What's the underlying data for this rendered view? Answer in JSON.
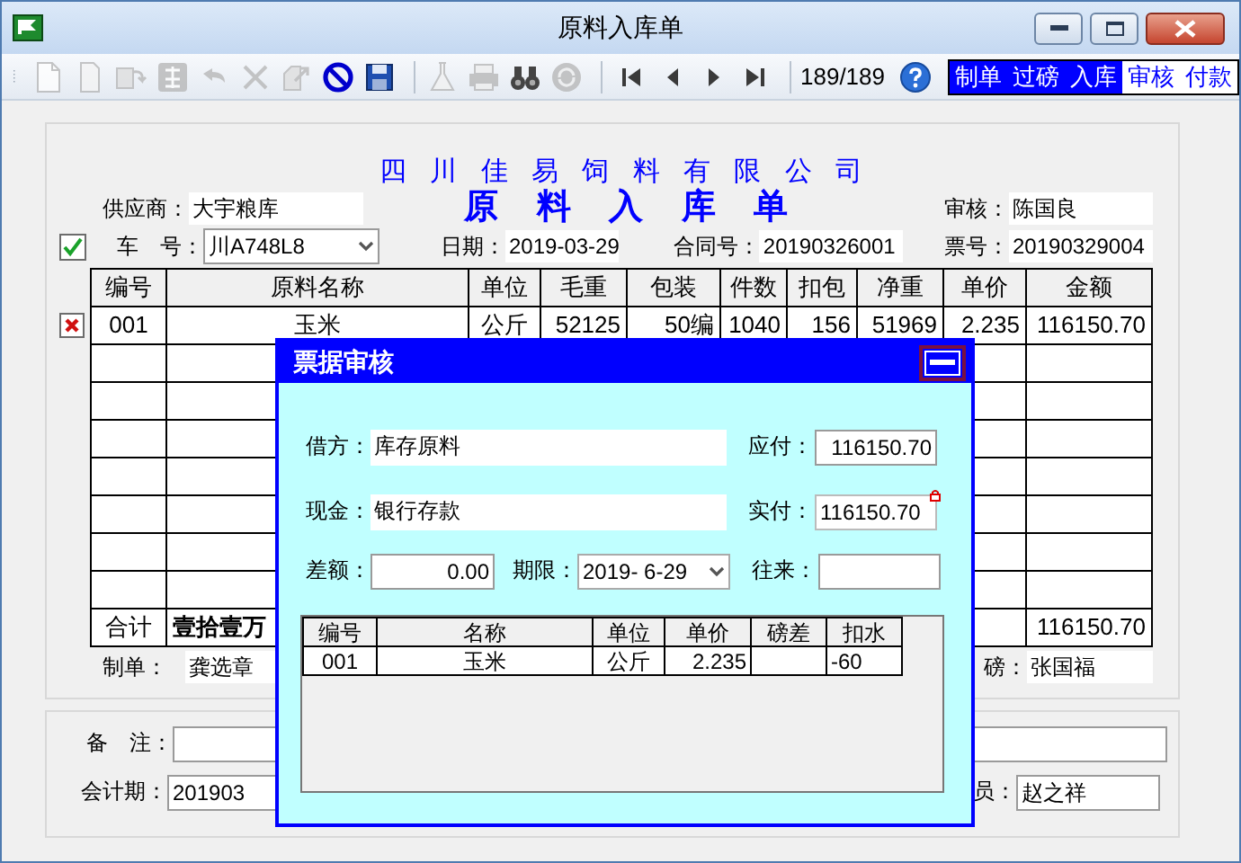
{
  "window": {
    "title": "原料入库单"
  },
  "toolbar": {
    "groups": [
      [
        {
          "kind": "new",
          "disabled": true
        },
        {
          "kind": "copy",
          "disabled": true
        },
        {
          "kind": "import",
          "disabled": true
        },
        {
          "kind": "audit",
          "disabled": true
        },
        {
          "kind": "undo",
          "disabled": true
        },
        {
          "kind": "delete",
          "disabled": true
        },
        {
          "kind": "export",
          "disabled": true
        },
        {
          "kind": "stop",
          "disabled": false
        },
        {
          "kind": "save",
          "disabled": false
        }
      ],
      [
        {
          "kind": "test",
          "disabled": true
        },
        {
          "kind": "print",
          "disabled": true
        },
        {
          "kind": "find",
          "disabled": false
        },
        {
          "kind": "refresh",
          "disabled": true
        }
      ],
      [
        {
          "kind": "first",
          "disabled": false
        },
        {
          "kind": "prev",
          "disabled": false
        },
        {
          "kind": "next",
          "disabled": false
        },
        {
          "kind": "last",
          "disabled": false
        }
      ]
    ],
    "record_counter": "189/189",
    "stages": [
      {
        "label": "制单",
        "done": true
      },
      {
        "label": "过磅",
        "done": true
      },
      {
        "label": "入库",
        "done": true
      },
      {
        "label": "审核",
        "done": false
      },
      {
        "label": "付款",
        "done": false
      }
    ]
  },
  "form": {
    "company": "四 川 佳 易 饲 料 有 限 公 司",
    "title": "原 料 入 库 单",
    "supplier": {
      "label": "供应商：",
      "value": "大宇粮库"
    },
    "auditor": {
      "label": "审核：",
      "value": "陈国良"
    },
    "verified": true,
    "vehicle": {
      "label": "车　号：",
      "value": "川A748L8"
    },
    "date": {
      "label": "日期：",
      "value": "2019-03-29"
    },
    "contract": {
      "label": "合同号：",
      "value": "20190326001"
    },
    "ticket": {
      "label": "票号：",
      "value": "20190329004"
    },
    "table": {
      "columns": [
        "编号",
        "原料名称",
        "单位",
        "毛重",
        "包装",
        "件数",
        "扣包",
        "净重",
        "单价",
        "金额"
      ],
      "rows": [
        [
          "001",
          "玉米",
          "公斤",
          "52125",
          "50编",
          "1040",
          "156",
          "51969",
          "2.235",
          "116150.70"
        ]
      ],
      "total": {
        "label": "合计",
        "in_words": "壹拾壹万",
        "amount": "116150.70"
      }
    },
    "maker": {
      "label": "制单：",
      "value": "龚选章"
    },
    "weigher": {
      "label": "磅：",
      "value": "张国福"
    }
  },
  "bottom": {
    "remarks": {
      "label": "备　注："
    },
    "period": {
      "label": "会计期：",
      "value": "201903"
    },
    "clerk": {
      "label": "员：",
      "value": "赵之祥"
    }
  },
  "dialog": {
    "title": "票据审核",
    "debit": {
      "label": "借方：",
      "value": "库存原料"
    },
    "payable": {
      "label": "应付：",
      "value": "116150.70"
    },
    "cash": {
      "label": "现金：",
      "value": "银行存款"
    },
    "paid": {
      "label": "实付：",
      "value": "116150.70",
      "locked": true
    },
    "difference": {
      "label": "差额：",
      "value": "0.00"
    },
    "due": {
      "label": "期限：",
      "value": "2019- 6-29"
    },
    "counterparty": {
      "label": "往来："
    },
    "table": {
      "columns": [
        "编号",
        "名称",
        "单位",
        "单价",
        "磅差",
        "扣水"
      ],
      "rows": [
        [
          "001",
          "玉米",
          "公斤",
          "2.235",
          null,
          "-60"
        ]
      ]
    }
  }
}
